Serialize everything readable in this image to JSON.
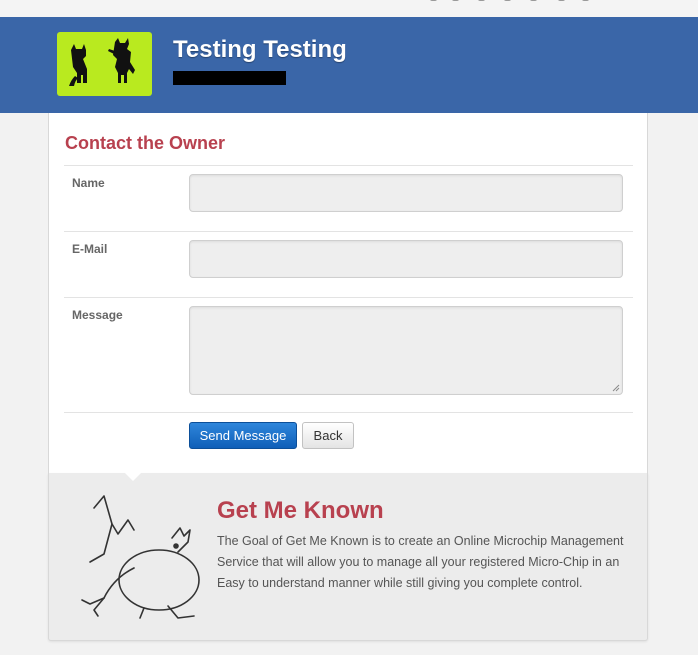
{
  "header": {
    "title": "Testing Testing",
    "logo_icon": "dog-silhouettes-icon"
  },
  "contact": {
    "title": "Contact the Owner",
    "fields": {
      "name_label": "Name",
      "email_label": "E-Mail",
      "message_label": "Message",
      "name_value": "",
      "email_value": "",
      "message_value": ""
    },
    "send_label": "Send Message",
    "back_label": "Back"
  },
  "promo": {
    "title": "Get Me Known",
    "body": "The Goal of Get Me Known is to create an Online Microchip Management Service that will allow you to manage all your registered Micro-Chip in an Easy to understand manner while still giving you complete control.",
    "art_icon": "dancing-dog-sketch-icon"
  },
  "colors": {
    "header_bg": "#3a66a8",
    "logo_bg": "#b9ea1f",
    "accent_red": "#b8414f",
    "primary_button": "#1a6fc8"
  }
}
